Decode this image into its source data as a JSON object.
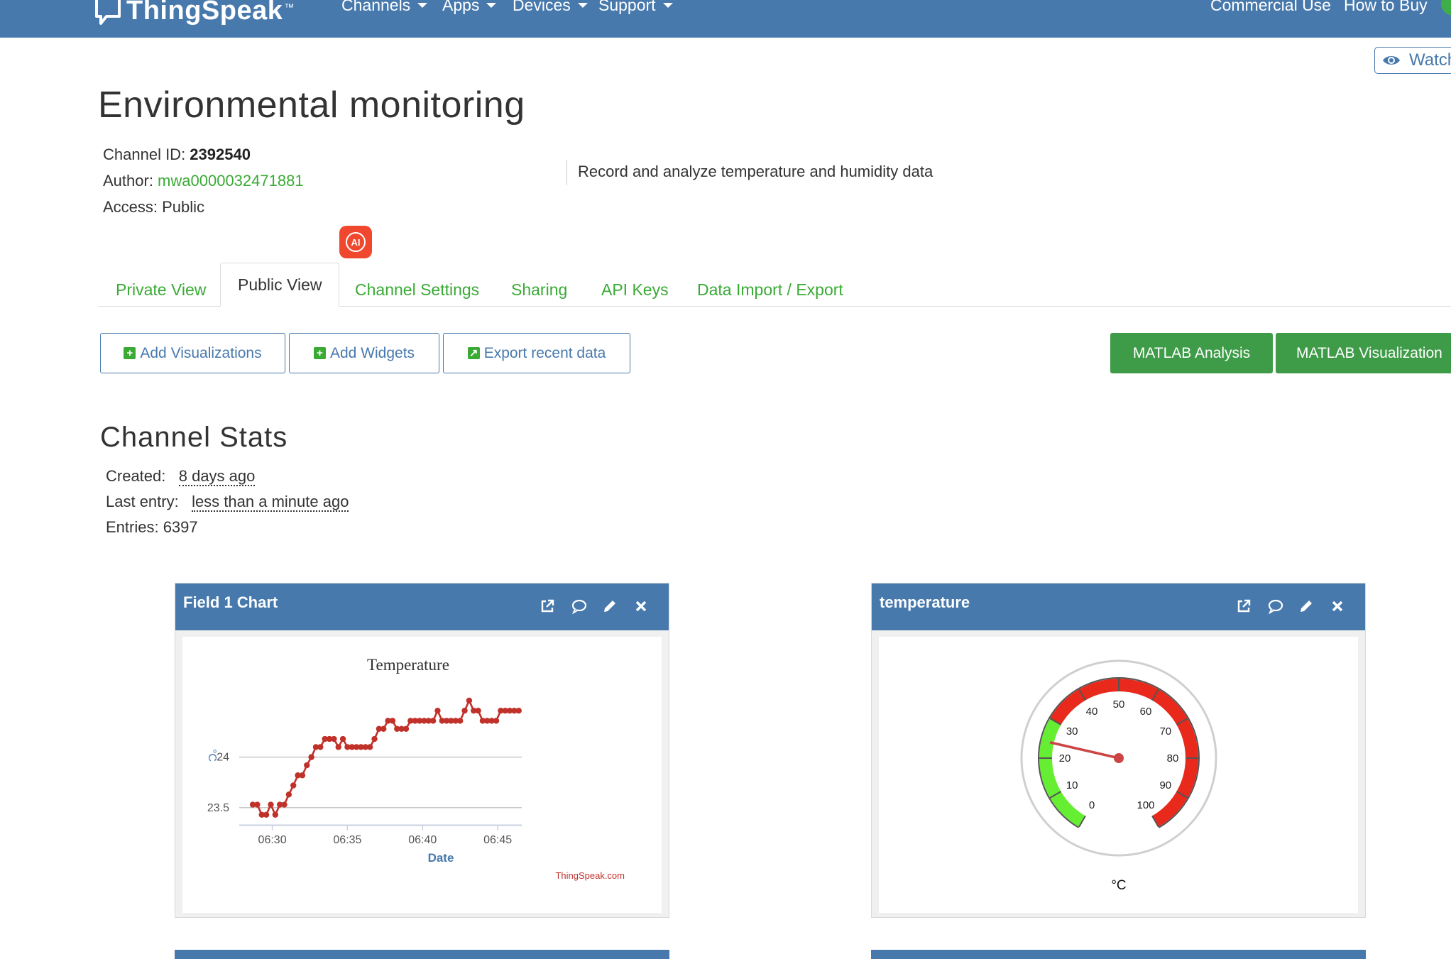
{
  "nav": {
    "brand": "ThingSpeak",
    "trademark": "™",
    "items": [
      "Channels",
      "Apps",
      "Devices",
      "Support"
    ],
    "right_items": [
      "Commercial Use",
      "How to Buy"
    ]
  },
  "watch_label": "Watch",
  "title": "Environmental monitoring",
  "channel": {
    "id_label": "Channel ID: ",
    "id": "2392540",
    "author_label": "Author: ",
    "author": "mwa0000032471881",
    "access": "Access: Public",
    "description": "Record and analyze temperature and humidity data"
  },
  "ai_badge": "AI",
  "tabs": [
    "Private View",
    "Public View",
    "Channel Settings",
    "Sharing",
    "API Keys",
    "Data Import / Export"
  ],
  "active_tab": "Public View",
  "buttons": {
    "add_visualizations": "Add Visualizations",
    "add_widgets": "Add Widgets",
    "export": "Export recent data",
    "matlab_analysis": "MATLAB Analysis",
    "matlab_visualization": "MATLAB Visualization"
  },
  "stats": {
    "title": "Channel Stats",
    "created_label": "Created:",
    "created": "8 days ago",
    "last_entry_label": "Last entry:",
    "last_entry": "less than a minute ago",
    "entries": "Entries: 6397"
  },
  "panels": {
    "field1_title": "Field 1 Chart",
    "gauge_title": "temperature"
  },
  "icons": [
    "external-link-icon",
    "comment-icon",
    "pencil-icon",
    "close-icon",
    "eye-icon",
    "plus-icon",
    "export-icon"
  ],
  "colors": {
    "navbar": "#4779ad",
    "link_green": "#3aaa35",
    "matlab_green": "#3e9b48",
    "series_red": "#c0312a",
    "gauge_red": "#e8291c",
    "gauge_green": "#66ee33"
  },
  "chart_data": [
    {
      "type": "line",
      "title": "Temperature",
      "xlabel": "Date",
      "ylabel": "°C",
      "credit": "ThingSpeak.com",
      "x_ticks": [
        "06:30",
        "06:35",
        "06:40",
        "06:45"
      ],
      "y_ticks": [
        "23.5",
        "24"
      ],
      "ylim": [
        23.33,
        24.7
      ],
      "grid": true,
      "x_minutes": [
        28.7,
        29.0,
        29.3,
        29.6,
        29.9,
        30.2,
        30.5,
        30.8,
        31.1,
        31.4,
        31.7,
        32.0,
        32.3,
        32.6,
        32.9,
        33.2,
        33.5,
        33.8,
        34.1,
        34.4,
        34.7,
        35.0,
        35.3,
        35.6,
        35.9,
        36.2,
        36.5,
        36.8,
        37.1,
        37.4,
        37.7,
        38.0,
        38.3,
        38.6,
        38.9,
        39.2,
        39.5,
        39.8,
        40.1,
        40.4,
        40.7,
        41.0,
        41.3,
        41.6,
        41.9,
        42.2,
        42.5,
        42.8,
        43.1,
        43.4,
        43.7,
        44.0,
        44.3,
        44.6,
        44.9,
        45.2,
        45.5,
        45.8,
        46.1,
        46.4
      ],
      "values": [
        23.53,
        23.53,
        23.43,
        23.43,
        23.53,
        23.43,
        23.53,
        23.53,
        23.63,
        23.72,
        23.82,
        23.82,
        23.92,
        24.0,
        24.1,
        24.1,
        24.18,
        24.18,
        24.18,
        24.1,
        24.18,
        24.1,
        24.1,
        24.1,
        24.1,
        24.1,
        24.1,
        24.18,
        24.28,
        24.28,
        24.36,
        24.36,
        24.28,
        24.28,
        24.28,
        24.36,
        24.36,
        24.36,
        24.36,
        24.36,
        24.36,
        24.46,
        24.36,
        24.36,
        24.36,
        24.36,
        24.36,
        24.46,
        24.56,
        24.46,
        24.46,
        24.36,
        24.36,
        24.36,
        24.36,
        24.46,
        24.46,
        24.46,
        24.46,
        24.46
      ]
    },
    {
      "type": "gauge",
      "unit": "°C",
      "min": 0,
      "max": 100,
      "ticks": [
        0,
        10,
        20,
        30,
        40,
        50,
        60,
        70,
        80,
        90,
        100
      ],
      "value": 24.3,
      "bands": [
        {
          "from": 0,
          "to": 30,
          "color": "green"
        },
        {
          "from": 30,
          "to": 100,
          "color": "red"
        }
      ]
    }
  ]
}
